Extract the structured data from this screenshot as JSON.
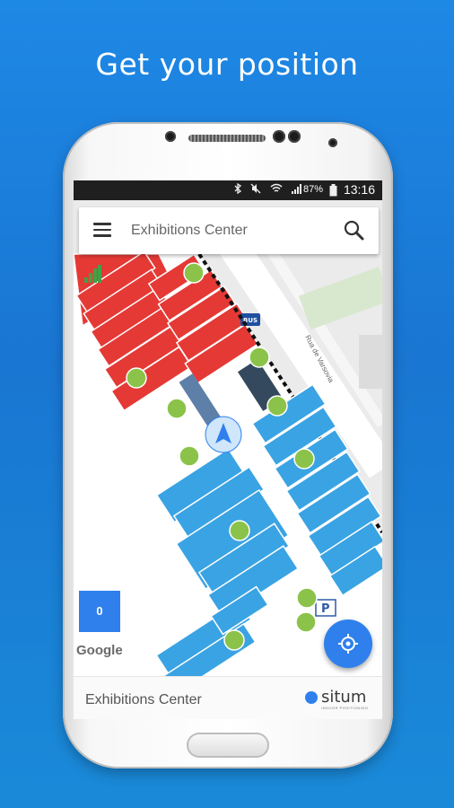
{
  "headline": "Get your position",
  "status_bar": {
    "battery_percent": "87%",
    "time": "13:16",
    "icons": [
      "bluetooth-icon",
      "mute-icon",
      "wifi-icon",
      "signal-icon",
      "battery-icon"
    ]
  },
  "search": {
    "placeholder": "Exhibitions Center"
  },
  "map": {
    "street_label": "Rua de Varsovia",
    "bus_label": "BUS",
    "floor_label": "0",
    "attribution": "Google"
  },
  "bottom_bar": {
    "title": "Exhibitions Center",
    "brand": "situm",
    "brand_tagline": "INDOOR POSITIONING"
  },
  "colors": {
    "background": "#1e88e5",
    "accent": "#2f80ed",
    "booth_red": "#e53935",
    "booth_blue": "#3aa3e3",
    "poi_green": "#8bc34a"
  }
}
